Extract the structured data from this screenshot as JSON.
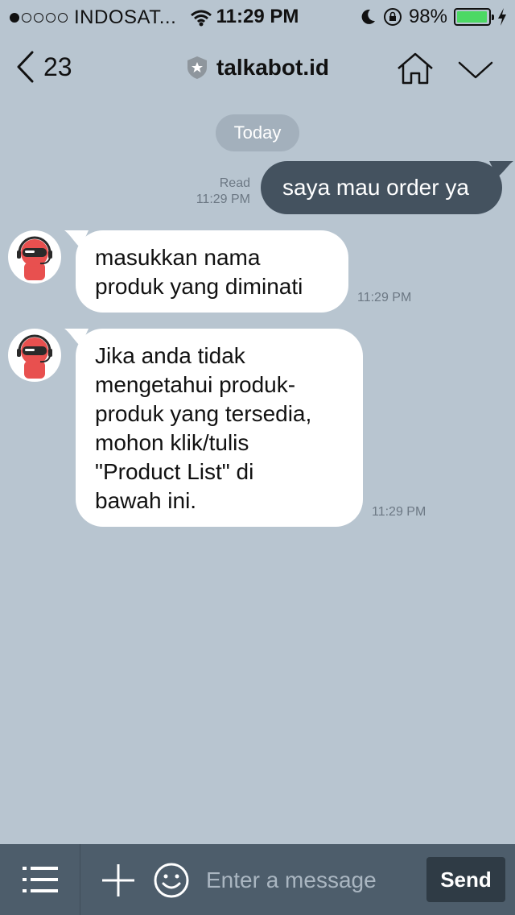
{
  "status_bar": {
    "carrier": "INDOSAT...",
    "time": "11:29 PM",
    "battery": "98%",
    "battery_level": 0.98,
    "battery_color": "#4cd964",
    "signal_filled": 1,
    "signal_total": 5
  },
  "header": {
    "back_count": "23",
    "title": "talkabot.id",
    "icons": [
      "chevron-left-icon",
      "shield-star-icon",
      "home-icon",
      "chevron-down-icon"
    ]
  },
  "chat": {
    "date_label": "Today",
    "messages": [
      {
        "from": "me",
        "text": "saya mau order ya",
        "status": "Read",
        "time": "11:29 PM"
      },
      {
        "from": "bot",
        "text": "masukkan nama\nproduk yang diminati",
        "time": "11:29 PM"
      },
      {
        "from": "bot",
        "text": "Jika anda tidak\nmengetahui produk-\nproduk yang tersedia,\nmohon klik/tulis\n\"Product List\" di\nbawah ini.",
        "time": "11:29 PM"
      }
    ]
  },
  "composer": {
    "placeholder": "Enter a message",
    "send_label": "Send",
    "icons": [
      "menu-icon",
      "plus-icon",
      "emoji-icon"
    ]
  },
  "colors": {
    "background": "#b8c5d0",
    "outgoing_bubble": "#44525f",
    "incoming_bubble": "#ffffff",
    "bottom_bar": "#4d5d6b",
    "avatar_accent": "#e8504f"
  }
}
